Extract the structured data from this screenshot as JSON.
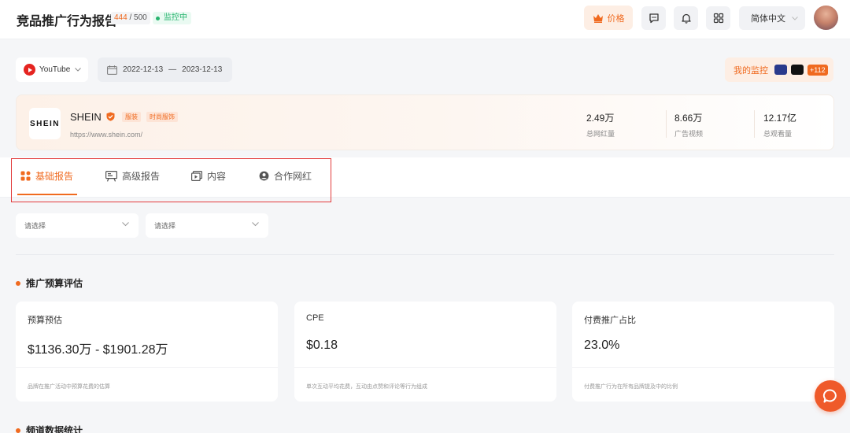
{
  "header": {
    "title": "竞品推广行为报告",
    "quota_used": "444",
    "quota_total": "/ 500",
    "monitor_status": "监控中",
    "price_label": "价格",
    "language": "简体中文"
  },
  "filters": {
    "platform": "YouTube",
    "date_start": "2022-12-13",
    "date_sep": "—",
    "date_end": "2023-12-13",
    "my_monitor_label": "我的监控",
    "my_monitor_count": "+112"
  },
  "brand": {
    "logo_text": "SHEIN",
    "name": "SHEIN",
    "tags": [
      "服装",
      "时尚服饰"
    ],
    "url": "https://www.shein.com/",
    "stats": [
      {
        "value": "2.49万",
        "label": "总网红量"
      },
      {
        "value": "8.66万",
        "label": "广告视频"
      },
      {
        "value": "12.17亿",
        "label": "总观看量"
      }
    ]
  },
  "tabs": [
    {
      "label": "基础报告",
      "icon": "grid-icon",
      "active": true
    },
    {
      "label": "高级报告",
      "icon": "presentation-icon",
      "active": false
    },
    {
      "label": "内容",
      "icon": "video-icon",
      "active": false
    },
    {
      "label": "合作网红",
      "icon": "user-icon",
      "active": false
    }
  ],
  "selects": [
    {
      "placeholder": "请选择"
    },
    {
      "placeholder": "请选择"
    }
  ],
  "sections": {
    "budget_title": "推广预算评估",
    "channel_title": "频道数据统计"
  },
  "metrics": [
    {
      "label": "预算预估",
      "value": "$1136.30万 - $1901.28万",
      "note": "品牌在推广活动中预算花费的估算"
    },
    {
      "label": "CPE",
      "value": "$0.18",
      "note": "单次互动平均花费，互动由点赞和评论等行为组成"
    },
    {
      "label": "付费推广占比",
      "value": "23.0%",
      "note": "付费推广行为在所有品牌提及中的比例"
    }
  ],
  "colors": {
    "accent": "#f06a1f",
    "status_green": "#27b46e",
    "highlight_red": "#e23b3b"
  }
}
